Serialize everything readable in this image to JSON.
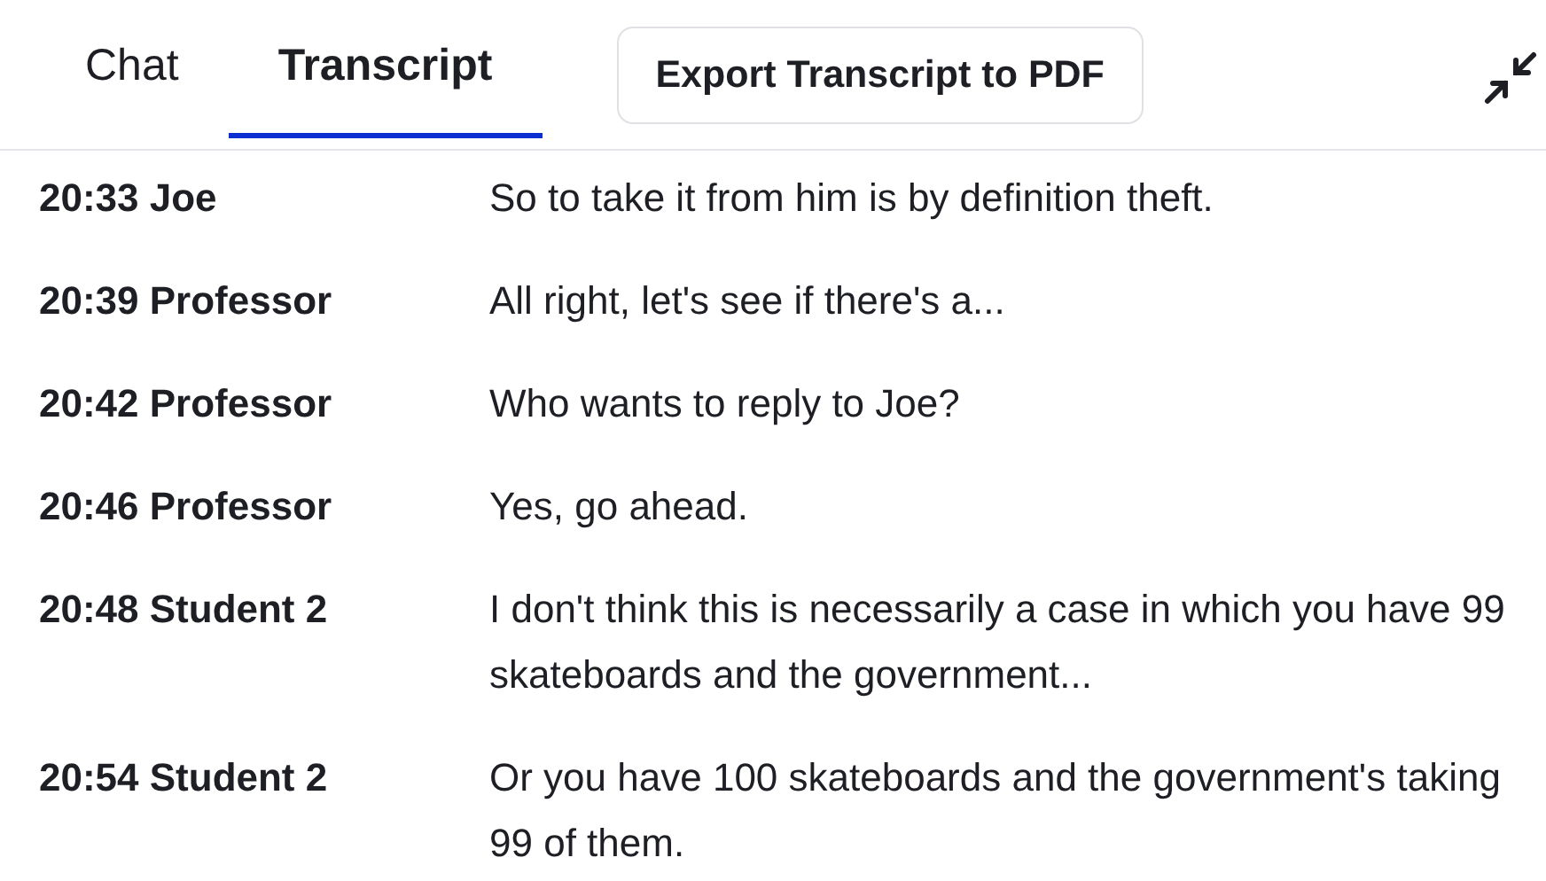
{
  "tabs": [
    {
      "label": "Chat",
      "selected": false
    },
    {
      "label": "Transcript",
      "selected": true
    }
  ],
  "export_button": "Export Transcript to PDF",
  "transcript": [
    {
      "time": "20:33",
      "speaker": "Joe",
      "text": "So to take it from him is by definition theft."
    },
    {
      "time": "20:39",
      "speaker": "Professor",
      "text": "All right, let's see if there's a..."
    },
    {
      "time": "20:42",
      "speaker": "Professor",
      "text": "Who wants to reply to Joe?"
    },
    {
      "time": "20:46",
      "speaker": "Professor",
      "text": "Yes, go ahead."
    },
    {
      "time": "20:48",
      "speaker": "Student 2",
      "text": "I don't think this is necessarily a case in which you have 99 skateboards and the government..."
    },
    {
      "time": "20:54",
      "speaker": "Student 2",
      "text": "Or you have 100 skateboards and the government's taking 99 of them."
    }
  ]
}
